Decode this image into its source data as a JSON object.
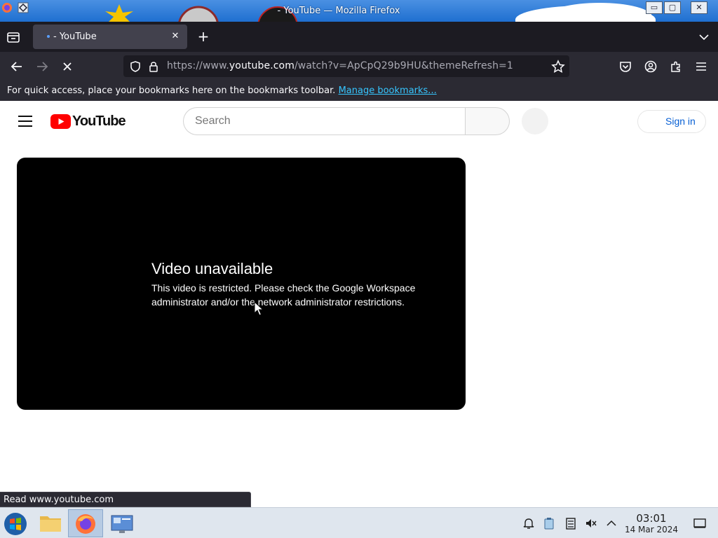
{
  "window": {
    "title": "- YouTube — Mozilla Firefox",
    "controls": {
      "minimize": "▭",
      "maximize": "▢",
      "close": "✕"
    }
  },
  "tabs": [
    {
      "label": "- YouTube",
      "active": true
    }
  ],
  "toolbar": {
    "url_prefix": "https://www.",
    "url_host": "youtube.com",
    "url_path": "/watch?v=ApCpQ29b9HU&themeRefresh=1"
  },
  "bookmarks_bar": {
    "message": "For quick access, place your bookmarks here on the bookmarks toolbar.",
    "manage_link": "Manage bookmarks..."
  },
  "youtube": {
    "logo_text": "YouTube",
    "search_placeholder": "Search",
    "sign_in_label": "Sign in",
    "player": {
      "error_title": "Video unavailable",
      "error_message": "This video is restricted. Please check the Google Workspace administrator and/or the network administrator restrictions."
    }
  },
  "status_bar": {
    "text": "Read www.youtube.com"
  },
  "taskbar": {
    "clock_time": "03:01",
    "clock_date": "14 Mar 2024"
  },
  "colors": {
    "firefox_dark": "#1c1b22",
    "toolbar": "#2b2a33",
    "youtube_red": "#ff0000",
    "link_blue": "#065fd4",
    "bookmark_link": "#36c6ff"
  }
}
